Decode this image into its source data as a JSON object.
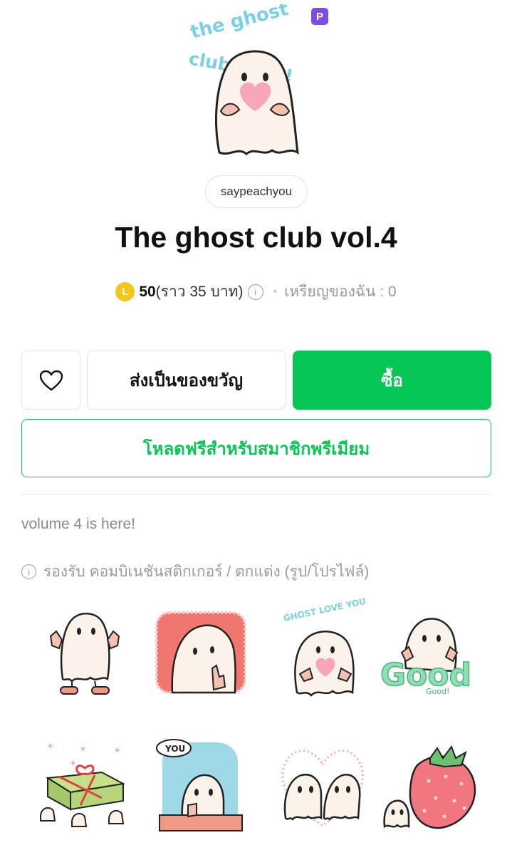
{
  "header": {
    "badge": "P",
    "author": "saypeachyou",
    "title": "The ghost club vol.4"
  },
  "price": {
    "coin_symbol": "L",
    "value": "50",
    "approx": "(ราว 35 บาท)",
    "info_glyph": "i",
    "separator": "•",
    "my_coins": "เหรียญของฉัน : 0"
  },
  "actions": {
    "gift_label": "ส่งเป็นของขวัญ",
    "buy_label": "ซื้อ",
    "premium_label": "โหลดฟรีสำหรับสมาชิกพรีเมียม"
  },
  "description": "volume 4 is here!",
  "support": {
    "info_glyph": "i",
    "text": "รองรับ คอมบิเนชันสติกเกอร์ / ตกแต่ง (รูป/โปรไฟล์)"
  },
  "sticker_texts": {
    "love_you": "GHOST LOVE YOU",
    "good": "Good",
    "good_small": "Good!",
    "you": "YOU"
  },
  "colors": {
    "green": "#06c755",
    "coin": "#f5c518",
    "premium_badge": "#7b4de0"
  }
}
